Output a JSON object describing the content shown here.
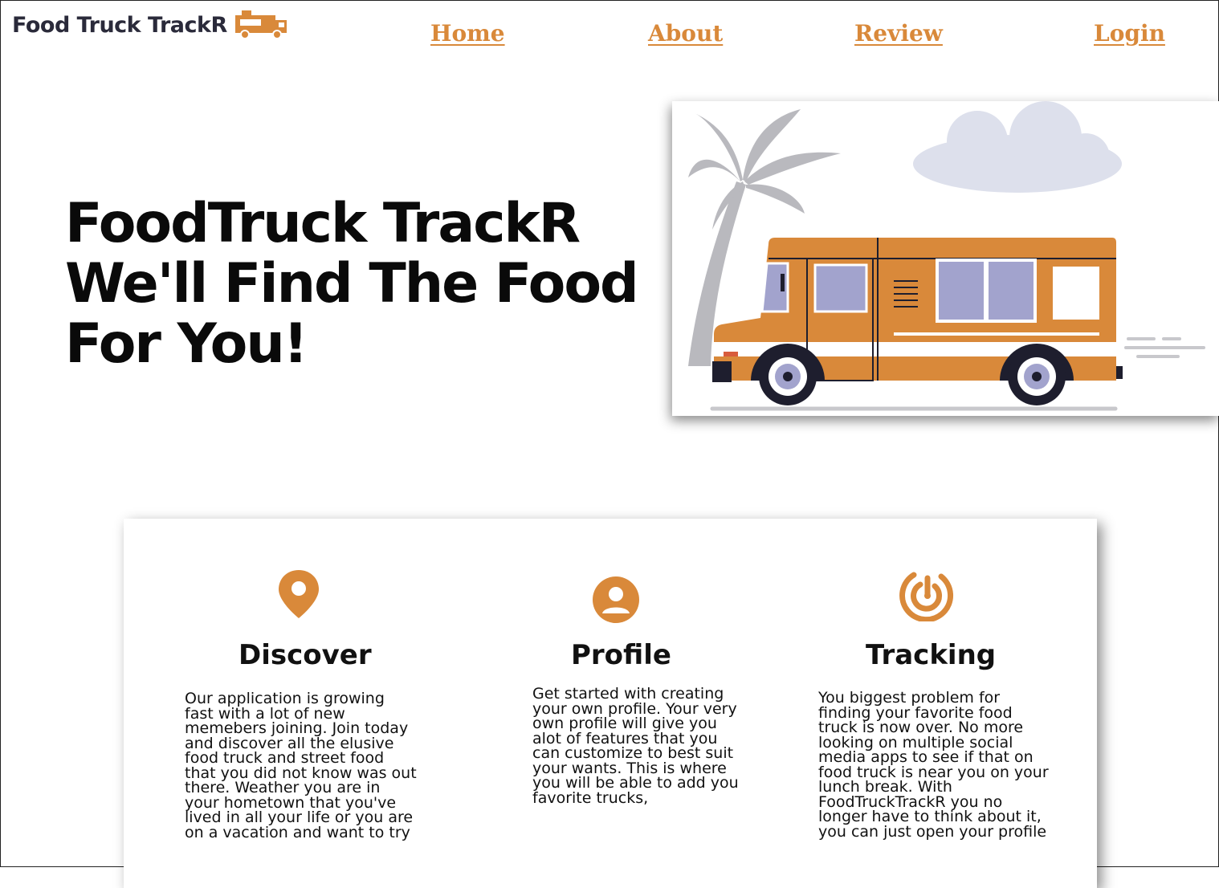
{
  "header": {
    "brand": "Food Truck TrackR",
    "brand_icon": "food-truck-icon",
    "nav": [
      {
        "label": "Home"
      },
      {
        "label": "About"
      },
      {
        "label": "Review"
      },
      {
        "label": "Login"
      }
    ]
  },
  "hero": {
    "title_lines": [
      "FoodTruck TrackR",
      "We'll Find The Food",
      "For You!"
    ],
    "image": "food-truck-illustration"
  },
  "features": [
    {
      "icon": "location-pin-icon",
      "title": "Discover",
      "text": "Our application is growing fast with a lot of new memebers joining. Join today and discover all the elusive food truck and street food that you did not know was out there. Weather you are in your hometown that you've lived in all your life or you are on a vacation and want to try"
    },
    {
      "icon": "user-profile-icon",
      "title": "Profile",
      "text": "Get started with creating your own profile. Your very own profile will give you alot of features that you can customize to best suit your wants. This is where you will be able to add you favorite trucks,"
    },
    {
      "icon": "radar-tracking-icon",
      "title": "Tracking",
      "text": "You biggest problem for finding your favorite food truck is now over. No more looking on multiple social media apps to see if that on food truck is near you on your lunch break. With FoodTruckTrackR you no longer have to think about it, you can just open your profile"
    }
  ],
  "colors": {
    "accent": "#d9893a",
    "brand_text": "#2a2a3a",
    "truck_window": "#a2a3cd",
    "palm": "#b9b9be",
    "cloud": "#dde0ec"
  }
}
